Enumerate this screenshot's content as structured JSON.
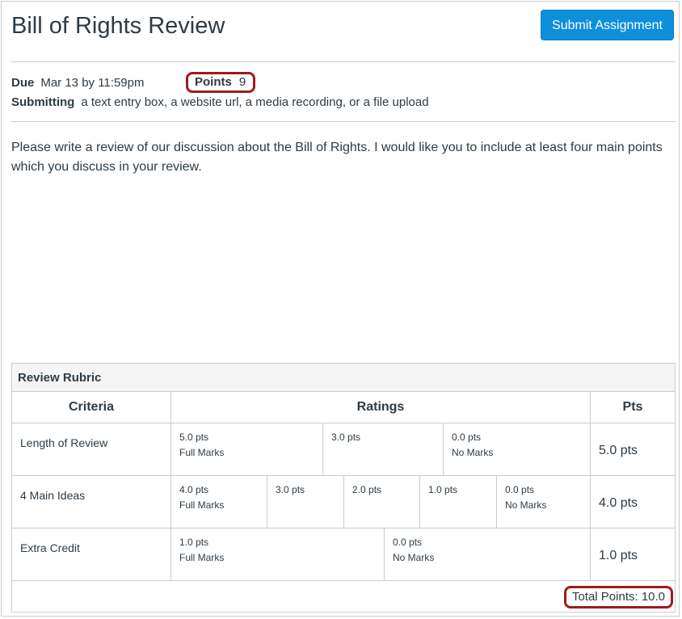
{
  "assignment": {
    "title": "Bill of Rights Review",
    "submit_label": "Submit Assignment",
    "due_label": "Due",
    "due_value": "Mar 13 by 11:59pm",
    "points_label": "Points",
    "points_value": "9",
    "submitting_label": "Submitting",
    "submitting_value": "a text entry box, a website url, a media recording, or a file upload",
    "description": "Please write a review of our discussion about the Bill of Rights. I would like you to include at least four main points which you discuss in your review."
  },
  "rubric": {
    "title": "Review Rubric",
    "headers": {
      "criteria": "Criteria",
      "ratings": "Ratings",
      "pts": "Pts"
    },
    "rows": [
      {
        "criterion": "Length of Review",
        "ratings": [
          {
            "pts": "5.0 pts",
            "desc": "Full Marks"
          },
          {
            "pts": "3.0 pts",
            "desc": ""
          },
          {
            "pts": "0.0 pts",
            "desc": "No Marks"
          }
        ],
        "points": "5.0 pts"
      },
      {
        "criterion": "4 Main Ideas",
        "ratings": [
          {
            "pts": "4.0 pts",
            "desc": "Full Marks"
          },
          {
            "pts": "3.0 pts",
            "desc": ""
          },
          {
            "pts": "2.0 pts",
            "desc": ""
          },
          {
            "pts": "1.0 pts",
            "desc": ""
          },
          {
            "pts": "0.0 pts",
            "desc": "No Marks"
          }
        ],
        "points": "4.0 pts"
      },
      {
        "criterion": "Extra Credit",
        "ratings": [
          {
            "pts": "1.0 pts",
            "desc": "Full Marks"
          },
          {
            "pts": "0.0 pts",
            "desc": "No Marks"
          }
        ],
        "points": "1.0 pts"
      }
    ],
    "total": "Total Points: 10.0"
  },
  "colors": {
    "primary_button": "#0e8fdb",
    "highlight_outline": "#a01b1b",
    "text": "#2d3b45",
    "border": "#c7cdd1"
  }
}
